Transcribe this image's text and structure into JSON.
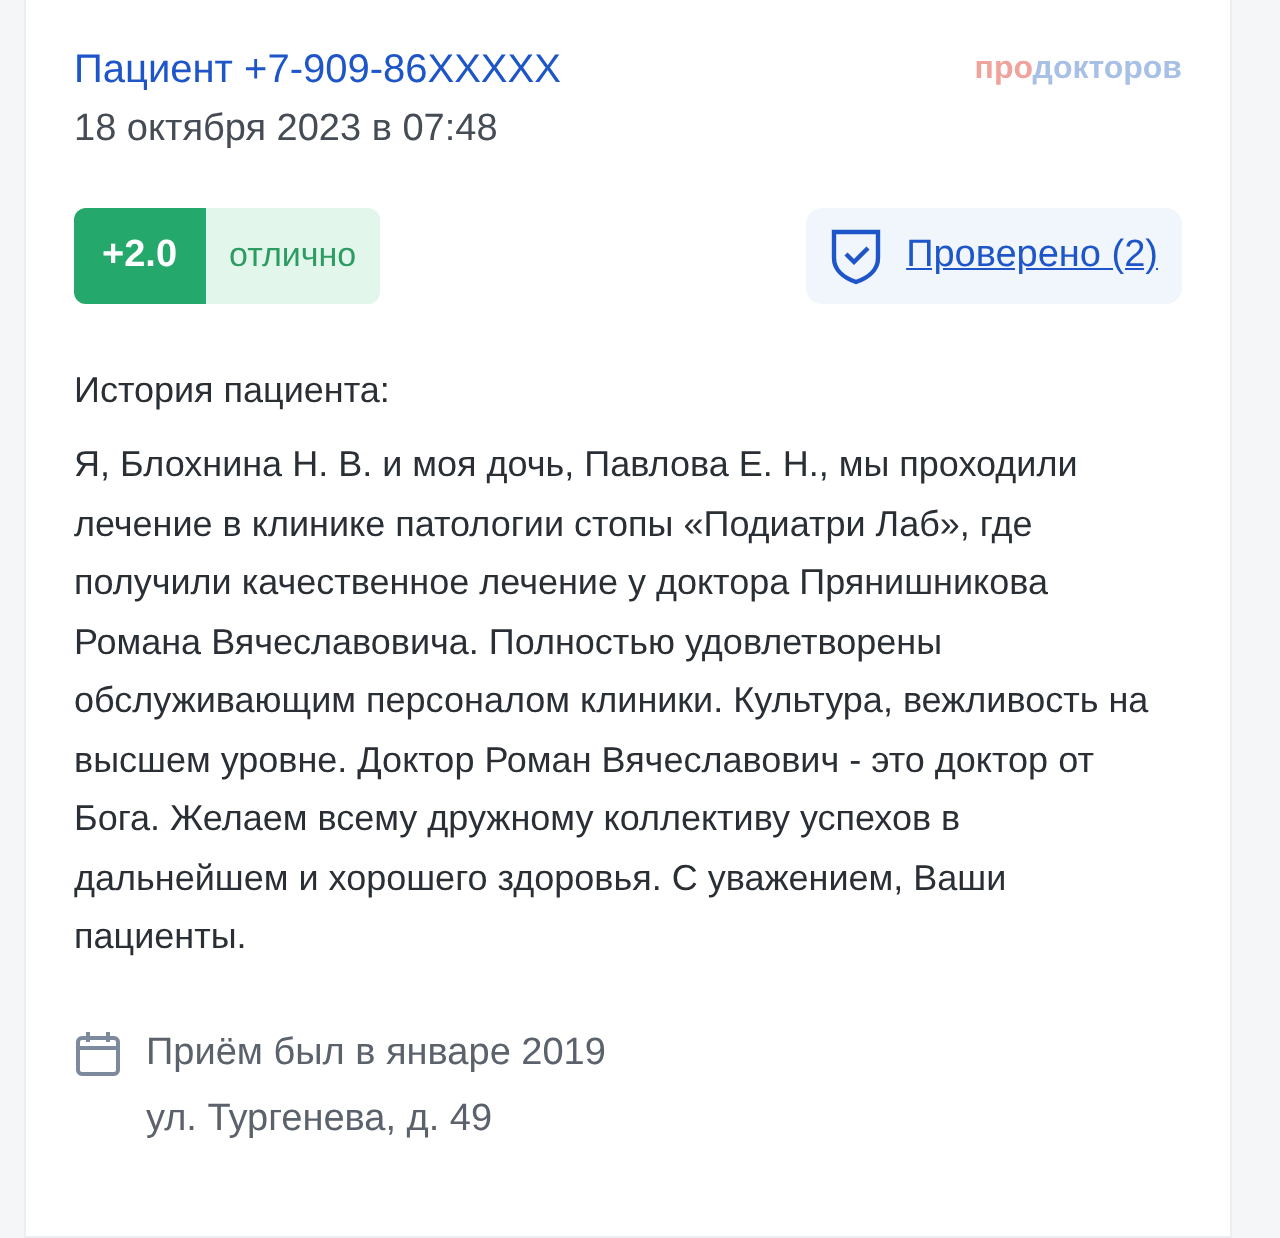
{
  "author": "Пациент +7-909-86XXXXX",
  "date": "18 октября 2023 в 07:48",
  "logo": {
    "prefix": "про",
    "suffix": "докторов"
  },
  "rating": {
    "score": "+2.0",
    "label": "отлично"
  },
  "verified": {
    "label": "Проверено (2)"
  },
  "history": {
    "heading": "История пациента:",
    "text": "Я, Блохнина Н. В. и моя дочь, Павлова Е. Н., мы проходили лечение в клинике патологии стопы «Подиатри Лаб», где получили качественное лечение у доктора Прянишникова Романа Вячеславовича. Полностью удовлетворены обслуживающим персоналом клиники. Культура, вежливость на высшем уровне. Доктор Роман Вячеславович - это доктор от Бога. Желаем всему дружному коллективу успехов в дальнейшем и хорошего здоровья. С уважением, Ваши пациенты."
  },
  "visit": {
    "when": "Приём был в январе 2019",
    "address": "ул. Тургенева, д. 49"
  }
}
